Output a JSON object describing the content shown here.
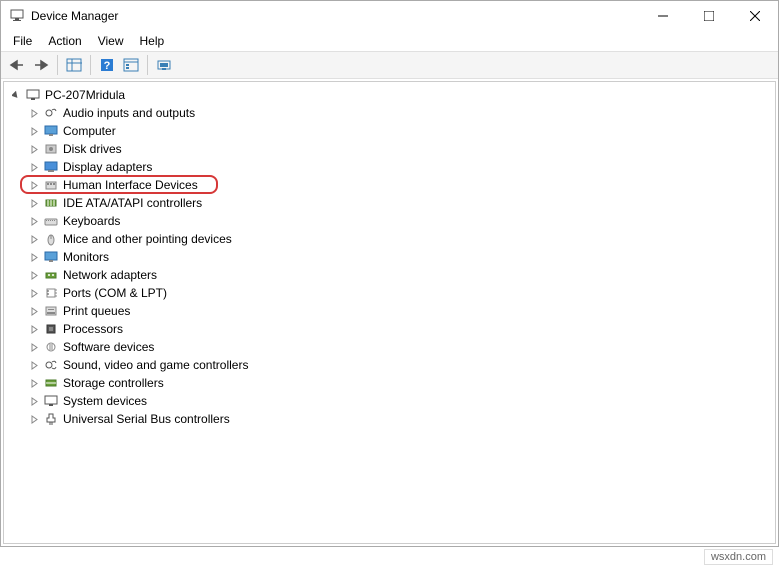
{
  "window": {
    "title": "Device Manager"
  },
  "menu": {
    "file": "File",
    "action": "Action",
    "view": "View",
    "help": "Help"
  },
  "tree": {
    "root": "PC-207Mridula",
    "items": [
      "Audio inputs and outputs",
      "Computer",
      "Disk drives",
      "Display adapters",
      "Human Interface Devices",
      "IDE ATA/ATAPI controllers",
      "Keyboards",
      "Mice and other pointing devices",
      "Monitors",
      "Network adapters",
      "Ports (COM & LPT)",
      "Print queues",
      "Processors",
      "Software devices",
      "Sound, video and game controllers",
      "Storage controllers",
      "System devices",
      "Universal Serial Bus controllers"
    ]
  },
  "highlighted_index": 4,
  "watermark": "wsxdn.com"
}
